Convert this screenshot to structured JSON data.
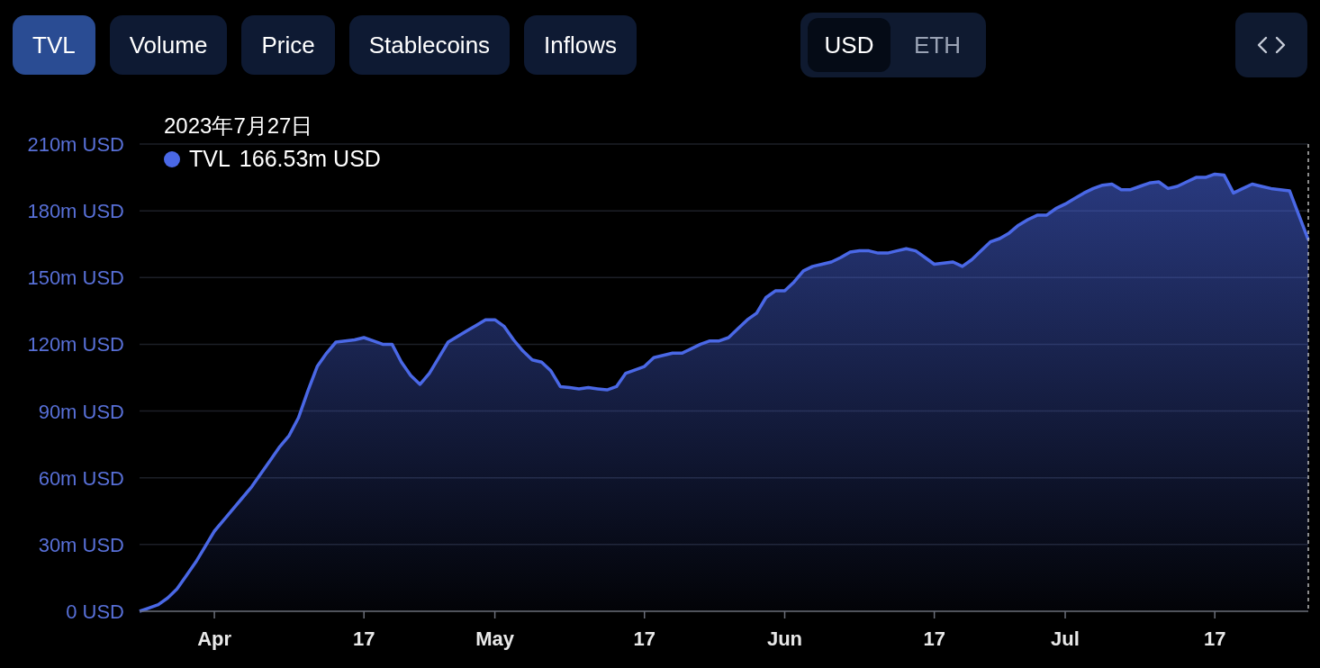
{
  "tabs": [
    {
      "label": "TVL",
      "selected": true
    },
    {
      "label": "Volume",
      "selected": false
    },
    {
      "label": "Price",
      "selected": false
    },
    {
      "label": "Stablecoins",
      "selected": false
    },
    {
      "label": "Inflows",
      "selected": false
    }
  ],
  "currency": [
    {
      "label": "USD",
      "selected": true
    },
    {
      "label": "ETH",
      "selected": false
    }
  ],
  "chart": {
    "tooltip": {
      "date": "2023年7月27日",
      "value": "166.53m USD"
    },
    "chart_data": {
      "type": "area",
      "categories": [
        null,
        null,
        null,
        null,
        null,
        null,
        null,
        null,
        "Apr",
        null,
        null,
        null,
        null,
        null,
        null,
        null,
        null,
        null,
        null,
        null,
        null,
        null,
        null,
        null,
        "17",
        null,
        null,
        null,
        null,
        null,
        null,
        null,
        null,
        null,
        null,
        null,
        null,
        null,
        "May",
        null,
        null,
        null,
        null,
        null,
        null,
        null,
        null,
        null,
        null,
        null,
        null,
        null,
        null,
        null,
        "17",
        null,
        null,
        null,
        null,
        null,
        null,
        null,
        null,
        null,
        null,
        null,
        null,
        null,
        null,
        "Jun",
        null,
        null,
        null,
        null,
        null,
        null,
        null,
        null,
        null,
        null,
        null,
        null,
        null,
        null,
        null,
        "17",
        null,
        null,
        null,
        null,
        null,
        null,
        null,
        null,
        null,
        null,
        null,
        null,
        null,
        "Jul",
        null,
        null,
        null,
        null,
        null,
        null,
        null,
        null,
        null,
        null,
        null,
        null,
        null,
        null,
        null,
        "17",
        null,
        null,
        null,
        null,
        null,
        null,
        null,
        null,
        null,
        null
      ],
      "series": [
        {
          "name": "TVL",
          "color": "#4a68e6",
          "values": [
            0,
            1.5,
            3,
            6,
            10,
            16,
            22,
            29,
            36,
            41,
            46,
            51,
            56,
            62,
            68,
            74,
            79,
            87,
            99,
            110,
            116,
            121,
            121.5,
            122,
            123,
            121.5,
            120,
            120,
            112,
            106,
            102,
            107,
            114,
            121,
            123.5,
            126,
            128.5,
            131,
            131,
            128,
            122,
            117,
            113,
            112,
            108,
            101,
            100.5,
            100,
            100.5,
            100,
            99.5,
            101,
            107,
            108.5,
            110,
            114,
            115,
            116,
            116,
            118,
            120,
            121.5,
            121.5,
            123,
            127,
            131,
            134,
            141,
            144,
            144,
            148,
            153,
            155,
            156,
            157,
            159,
            161.5,
            162,
            162,
            161,
            161,
            162,
            163,
            162,
            159,
            156,
            156.5,
            157,
            155,
            158,
            162,
            166,
            167.5,
            170,
            173.5,
            176,
            178,
            178,
            181,
            183,
            185.5,
            188,
            190,
            191.5,
            192,
            189.5,
            189.5,
            191,
            192.5,
            193,
            190,
            191,
            193,
            195,
            195,
            196.5,
            196,
            188,
            190,
            192,
            191,
            190,
            189.5,
            189,
            178,
            167
          ]
        }
      ],
      "ylim": [
        0,
        210
      ],
      "grid": true,
      "yticks": [
        {
          "value": 0,
          "label": "0 USD"
        },
        {
          "value": 30,
          "label": "30m USD"
        },
        {
          "value": 60,
          "label": "60m USD"
        },
        {
          "value": 90,
          "label": "90m USD"
        },
        {
          "value": 120,
          "label": "120m USD"
        },
        {
          "value": 150,
          "label": "150m USD"
        },
        {
          "value": 180,
          "label": "180m USD"
        },
        {
          "value": 210,
          "label": "210m USD"
        }
      ]
    }
  }
}
